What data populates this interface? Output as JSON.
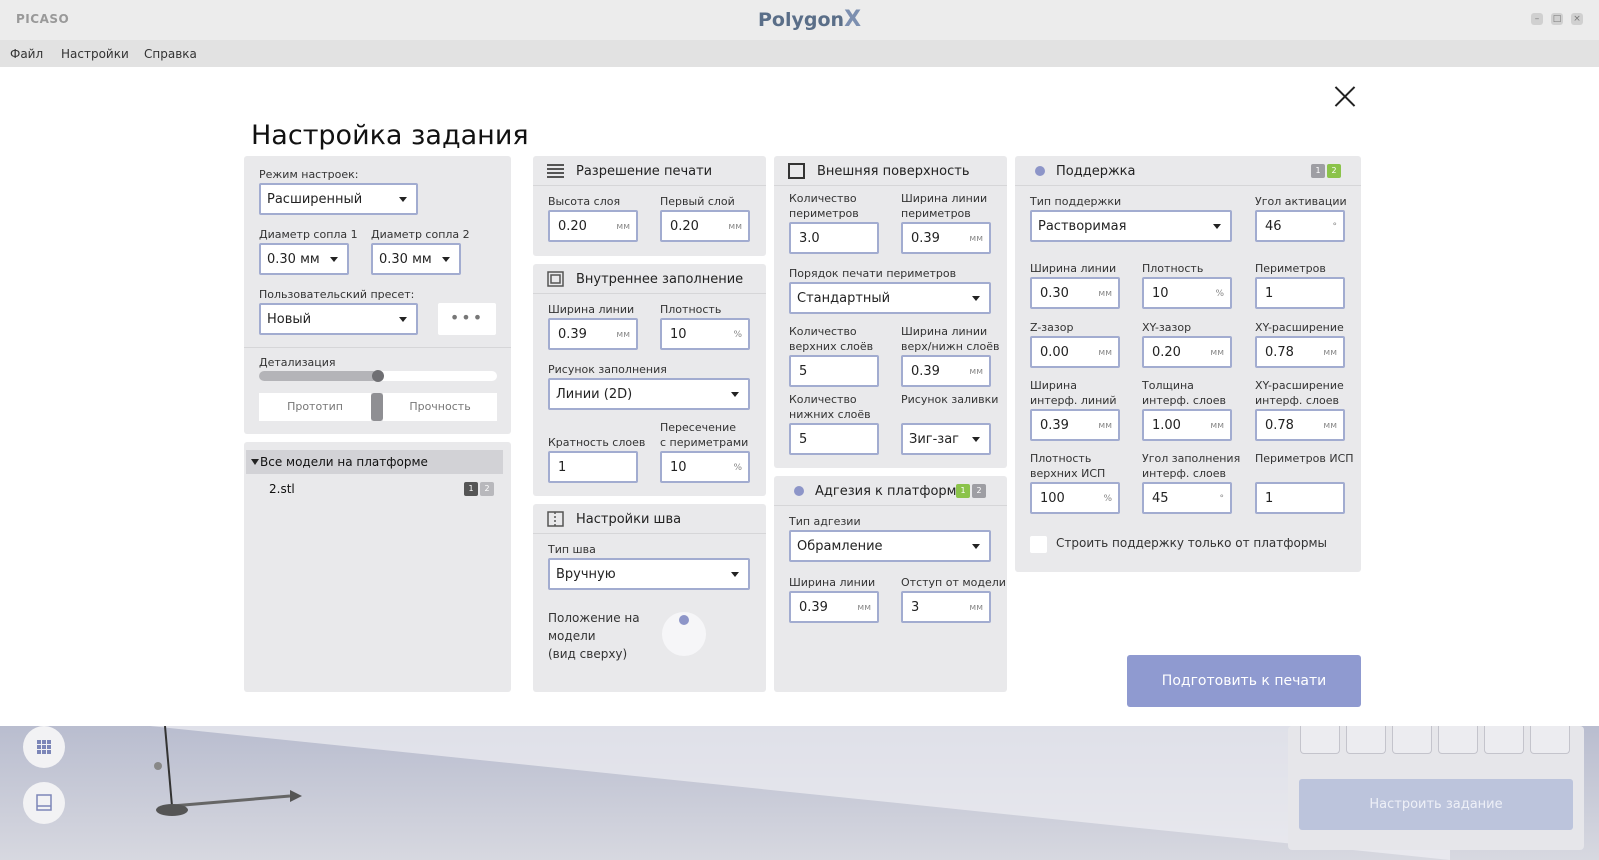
{
  "titlebar": {
    "brand": "PICASO",
    "app_title": "Polygon",
    "app_title_x": "X"
  },
  "menu": {
    "items": [
      "Файл",
      "Настройки",
      "Справка"
    ]
  },
  "dialog": {
    "title": "Настройка задания",
    "general": {
      "mode_label": "Режим настроек:",
      "mode_value": "Расширенный",
      "nozzle1_label": "Диаметр сопла 1",
      "nozzle1_value": "0.30 мм",
      "nozzle2_label": "Диаметр сопла 2",
      "nozzle2_value": "0.30 мм",
      "preset_label": "Пользовательский пресет:",
      "preset_value": "Новый",
      "preset_more": "•••",
      "detail_label": "Детализация",
      "detail_level": 0.5,
      "seg_left": "Прототип",
      "seg_right": "Прочность"
    },
    "models": {
      "header": "Все модели на платформе",
      "items": [
        {
          "name": "2.stl"
        }
      ]
    },
    "print_resolution": {
      "title": "Разрешение печати",
      "layer_height_label": "Высота слоя",
      "layer_height_value": "0.20",
      "layer_height_unit": "мм",
      "first_layer_label": "Первый слой",
      "first_layer_value": "0.20",
      "first_layer_unit": "мм"
    },
    "infill": {
      "title": "Внутреннее заполнение",
      "line_width_label": "Ширина линии",
      "line_width_value": "0.39",
      "line_width_unit": "мм",
      "density_label": "Плотность",
      "density_value": "10",
      "density_unit": "%",
      "pattern_label": "Рисунок заполнения",
      "pattern_value": "Линии (2D)",
      "layer_mult_label": "Кратность слоев",
      "layer_mult_value": "1",
      "overlap_label_1": "Пересечение",
      "overlap_label_2": "с периметрами",
      "overlap_value": "10",
      "overlap_unit": "%"
    },
    "seam": {
      "title": "Настройки шва",
      "type_label": "Тип шва",
      "type_value": "Вручную",
      "position_label_1": "Положение на",
      "position_label_2": "модели",
      "position_label_3": "(вид сверху)"
    },
    "outer_surface": {
      "title": "Внешняя поверхность",
      "perim_count_label_1": "Количество",
      "perim_count_label_2": "периметров",
      "perim_count_value": "3.0",
      "perim_width_label_1": "Ширина линии",
      "perim_width_label_2": "периметров",
      "perim_width_value": "0.39",
      "perim_width_unit": "мм",
      "order_label": "Порядок печати периметров",
      "order_value": "Стандартный",
      "top_count_label_1": "Количество",
      "top_count_label_2": "верхних слоёв",
      "top_count_value": "5",
      "tb_width_label_1": "Ширина линии",
      "tb_width_label_2": "верх/нижн слоёв",
      "tb_width_value": "0.39",
      "tb_width_unit": "мм",
      "bottom_count_label_1": "Количество",
      "bottom_count_label_2": "нижних слоёв",
      "bottom_count_value": "5",
      "fill_pattern_label": "Рисунок заливки",
      "fill_pattern_value": "Зиг-заг"
    },
    "adhesion": {
      "title": "Адгезия к платформе",
      "type_label": "Тип адгезии",
      "type_value": "Обрамление",
      "line_width_label": "Ширина линии",
      "line_width_value": "0.39",
      "line_width_unit": "мм",
      "offset_label": "Отступ от модели",
      "offset_value": "3",
      "offset_unit": "мм"
    },
    "support": {
      "title": "Поддержка",
      "type_label": "Тип поддержки",
      "type_value": "Растворимая",
      "angle_label": "Угол активации",
      "angle_value": "46",
      "angle_unit": "°",
      "line_width_label": "Ширина линии",
      "line_width_value": "0.30",
      "line_width_unit": "мм",
      "density_label": "Плотность",
      "density_value": "10",
      "density_unit": "%",
      "perimeters_label": "Периметров",
      "perimeters_value": "1",
      "z_gap_label": "Z-зазор",
      "z_gap_value": "0.00",
      "z_gap_unit": "мм",
      "xy_gap_label": "XY-зазор",
      "xy_gap_value": "0.20",
      "xy_gap_unit": "мм",
      "xy_exp_label": "XY-расширение",
      "xy_exp_value": "0.78",
      "xy_exp_unit": "мм",
      "iface_width_label_1": "Ширина",
      "iface_width_label_2": "интерф. линий",
      "iface_width_value": "0.39",
      "iface_width_unit": "мм",
      "iface_thick_label_1": "Толщина",
      "iface_thick_label_2": "интерф. слоев",
      "iface_thick_value": "1.00",
      "iface_thick_unit": "мм",
      "iface_exp_label_1": "XY-расширение",
      "iface_exp_label_2": "интерф. слоев",
      "iface_exp_value": "0.78",
      "iface_exp_unit": "мм",
      "top_density_label_1": "Плотность",
      "top_density_label_2": "верхних ИСП",
      "top_density_value": "100",
      "top_density_unit": "%",
      "fill_angle_label_1": "Угол заполнения",
      "fill_angle_label_2": "интерф. слоев",
      "fill_angle_value": "45",
      "fill_angle_unit": "°",
      "isp_perim_label": "Периметров ИСП",
      "isp_perim_value": "1",
      "platform_only_label": "Строить поддержку только от платформы"
    },
    "prepare_button": "Подготовить к печати",
    "nozzle_badge_1": "1",
    "nozzle_badge_2": "2"
  },
  "background": {
    "setup_button": "Настроить задание"
  },
  "colors": {
    "accent": "#8f9ad0",
    "field_border": "#a2acd0",
    "panel": "#e9e9eb",
    "nozzle_active_green": "#8bc34a"
  }
}
